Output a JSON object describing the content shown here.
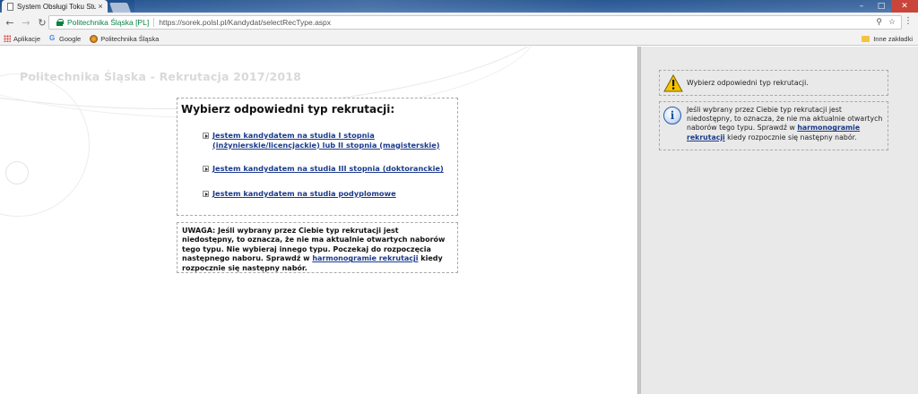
{
  "browser": {
    "tab_title": "System Obsługi Toku Stu",
    "tab_close": "×",
    "security_label": "Politechnika Śląska [PL]",
    "url": "https://sorek.polsl.pl/Kandydat/selectRecType.aspx",
    "bookmarks": [
      {
        "label": "Aplikacje",
        "icon": "apps-icon"
      },
      {
        "label": "Google",
        "icon": "google-icon"
      },
      {
        "label": "Politechnika Śląska",
        "icon": "polsl-icon"
      }
    ],
    "other_bookmarks": "Inne zakładki"
  },
  "page": {
    "site_title": "Politechnika Śląska - Rekrutacja 2017/2018",
    "heading": "Wybierz odpowiedni typ rekrutacji:",
    "options": [
      {
        "line1": "Jestem kandydatem na studia I stopnia",
        "line2": "(inżynierskie/licencjackie) lub II stopnia (magisterskie)"
      },
      {
        "line1": "Jestem kandydatem na studia III stopnia (doktoranckie)"
      },
      {
        "line1": "Jestem kandydatem na studia podyplomowe"
      }
    ],
    "note": {
      "text_before": "UWAGA: Jeśli wybrany przez Ciebie typ rekrutacji jest niedostępny, to oznacza, że nie ma aktualnie otwartych naborów tego typu. Nie wybieraj innego typu. Poczekaj do rozpoczęcia następnego naboru. Sprawdź w ",
      "link": "harmonogramie rekrutacji",
      "text_after": " kiedy rozpocznie się następny nabór."
    }
  },
  "sidebar": {
    "warning": "Wybierz odpowiedni typ rekrutacji.",
    "info": {
      "text_before": "Jeśli wybrany przez Ciebie typ rekrutacji jest niedostępny, to oznacza, że nie ma aktualnie otwartych naborów tego typu. Sprawdź w ",
      "link": "harmonogramie rekrutacji",
      "text_after": " kiedy rozpocznie się następny nabór."
    }
  },
  "colors": {
    "link": "#1a3a8c",
    "secure": "#0b8043",
    "sidebar_bg": "#e9e9e9"
  }
}
